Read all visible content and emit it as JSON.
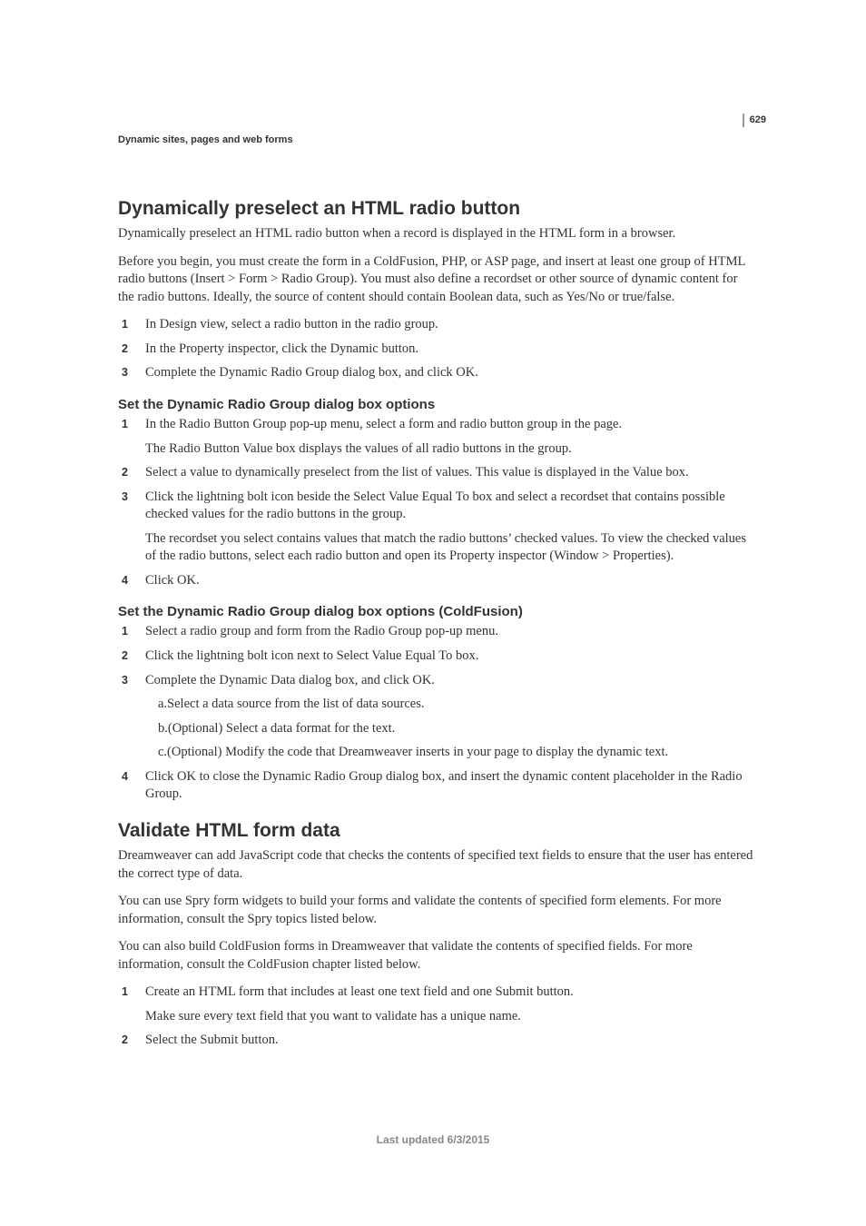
{
  "page_number": "629",
  "breadcrumb": "Dynamic sites, pages and web forms",
  "h2_1": "Dynamically preselect an HTML radio button",
  "p1": "Dynamically preselect an HTML radio button when a record is displayed in the HTML form in a browser.",
  "p2": "Before you begin, you must create the form in a ColdFusion, PHP, or ASP page, and insert at least one group of HTML radio buttons (Insert > Form > Radio Group). You must also define a recordset or other source of dynamic content for the radio buttons. Ideally, the source of content should contain Boolean data, such as Yes/No or true/false.",
  "list1": {
    "i1": "In Design view, select a radio button in the radio group.",
    "i2": "In the Property inspector, click the Dynamic button.",
    "i3": "Complete the Dynamic Radio Group dialog box, and click OK."
  },
  "h3_1": "Set the Dynamic Radio Group dialog box options",
  "list2": {
    "i1": "In the Radio Button Group pop-up menu, select a form and radio button group in the page.",
    "i1b": "The Radio Button Value box displays the values of all radio buttons in the group.",
    "i2": "Select a value to dynamically preselect from the list of values. This value is displayed in the Value box.",
    "i3": "Click the lightning bolt icon beside the Select Value Equal To box and select a recordset that contains possible checked values for the radio buttons in the group.",
    "i3b": "The recordset you select contains values that match the radio buttons’ checked values. To view the checked values of the radio buttons, select each radio button and open its Property inspector (Window > Properties).",
    "i4": "Click OK."
  },
  "h3_2": "Set the Dynamic Radio Group dialog box options (ColdFusion)",
  "list3": {
    "i1": "Select a radio group and form from the Radio Group pop-up menu.",
    "i2": "Click the lightning bolt icon next to Select Value Equal To box.",
    "i3": "Complete the Dynamic Data dialog box, and click OK.",
    "i3a": "a.Select a data source from the list of data sources.",
    "i3b": "b.(Optional) Select a data format for the text.",
    "i3c": "c.(Optional) Modify the code that Dreamweaver inserts in your page to display the dynamic text.",
    "i4": "Click OK to close the Dynamic Radio Group dialog box, and insert the dynamic content placeholder in the Radio Group."
  },
  "h2_2": "Validate HTML form data",
  "p3": "Dreamweaver can add JavaScript code that checks the contents of specified text fields to ensure that the user has entered the correct type of data.",
  "p4": "You can use Spry form widgets to build your forms and validate the contents of specified form elements. For more information, consult the Spry topics listed below.",
  "p5": "You can also build ColdFusion forms in Dreamweaver that validate the contents of specified fields. For more information, consult the ColdFusion chapter listed below.",
  "list4": {
    "i1": "Create an HTML form that includes at least one text field and one Submit button.",
    "i1b": "Make sure every text field that you want to validate has a unique name.",
    "i2": "Select the Submit button."
  },
  "footer": "Last updated 6/3/2015",
  "nums": {
    "n1": "1",
    "n2": "2",
    "n3": "3",
    "n4": "4"
  }
}
